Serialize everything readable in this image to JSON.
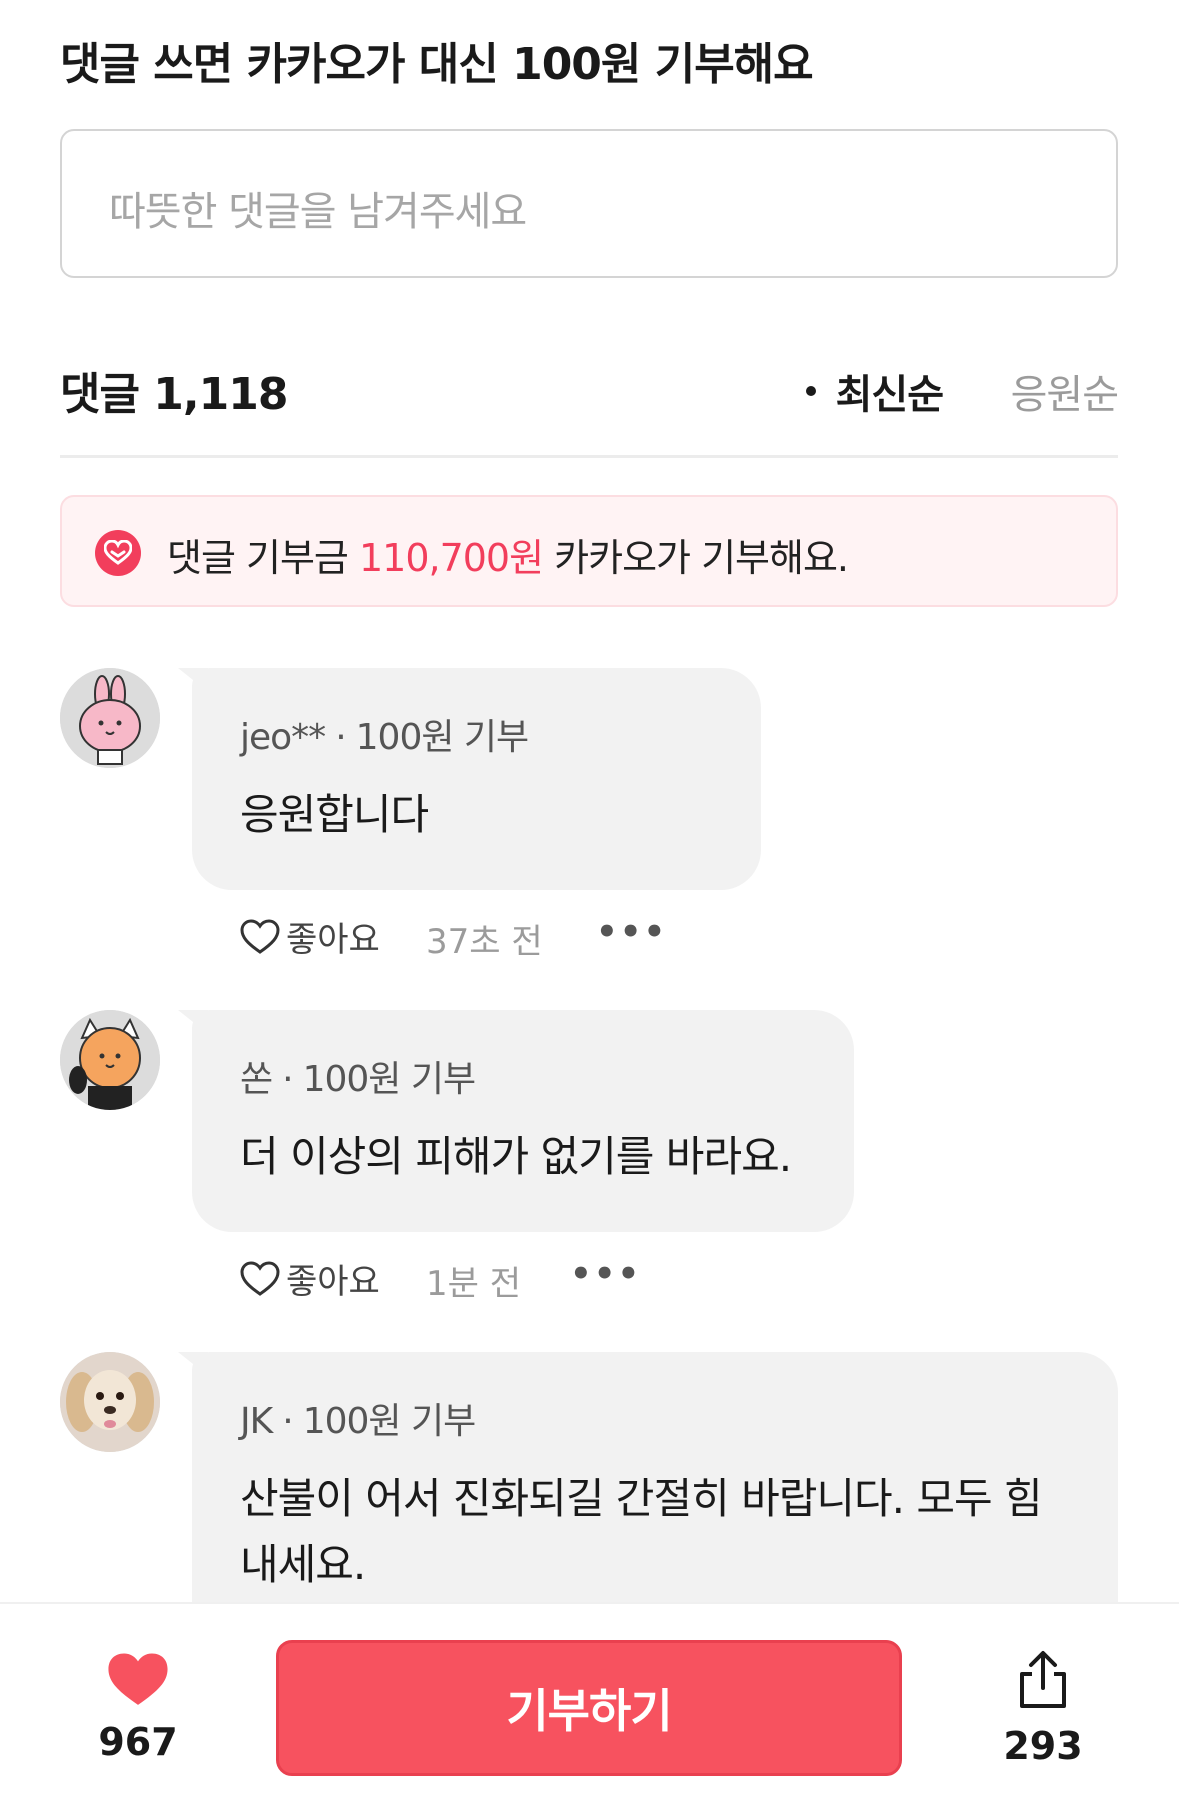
{
  "header": {
    "title": "댓글 쓰면 카카오가 대신 100원 기부해요"
  },
  "comment_input": {
    "placeholder": "따뜻한 댓글을 남겨주세요"
  },
  "comments_header": {
    "title": "댓글 1,118",
    "sort_latest": "최신순",
    "sort_support": "응원순"
  },
  "banner": {
    "prefix": "댓글 기부금 ",
    "amount": "110,700원",
    "suffix": " 카카오가 기부해요."
  },
  "comments": [
    {
      "author": "jeo**",
      "donation": "100원 기부",
      "text": "응원합니다",
      "like_label": "좋아요",
      "time": "37초 전",
      "more": "•••"
    },
    {
      "author": "쏜",
      "donation": "100원 기부",
      "text": "더 이상의 피해가 없기를 바라요.",
      "like_label": "좋아요",
      "time": "1분 전",
      "more": "•••"
    },
    {
      "author": "JK",
      "donation": "100원 기부",
      "text_line1": "산불이 어서 진화되길 간절히 바랍니다. 모두 힘",
      "text_line2": "내세요."
    }
  ],
  "bottom_bar": {
    "like_count": "967",
    "donate_label": "기부하기",
    "share_count": "293"
  },
  "colors": {
    "accent": "#f7525f",
    "banner_bg": "#fff3f4",
    "bubble_bg": "#f2f2f2"
  },
  "icons": [
    "heart-icon",
    "heart-outline-icon",
    "share-icon",
    "donation-heart-icon",
    "more-icon"
  ]
}
